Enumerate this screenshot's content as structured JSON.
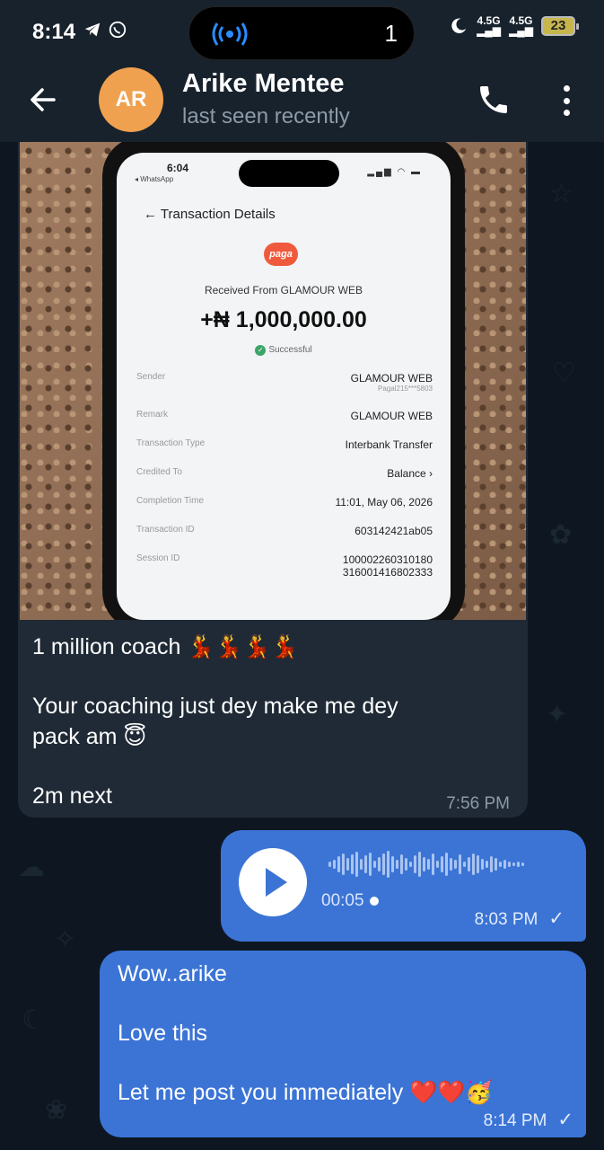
{
  "status_bar": {
    "time": "8:14",
    "island_count": "1",
    "network_1": "4.5G",
    "network_2": "4.5G",
    "battery": "23"
  },
  "header": {
    "avatar_initials": "AR",
    "avatar_color": "#f0a14f",
    "contact_name": "Arike Mentee",
    "contact_status": "last seen recently",
    "icons": [
      "back-arrow-icon",
      "phone-icon",
      "more-vert-icon"
    ]
  },
  "incoming_message": {
    "photo": {
      "phone_time": "6:04",
      "phone_back_app": "◂ WhatsApp",
      "screen_title": "Transaction Details",
      "brand": "paga",
      "received_from": "Received From GLAMOUR WEB",
      "amount": "+₦ 1,000,000.00",
      "status": "Successful",
      "details": [
        {
          "label": "Sender",
          "value": "GLAMOUR WEB",
          "sub": "Pagal215***5803"
        },
        {
          "label": "Remark",
          "value": "GLAMOUR WEB",
          "sub": ""
        },
        {
          "label": "Transaction Type",
          "value": "Interbank Transfer",
          "sub": ""
        },
        {
          "label": "Credited To",
          "value": "Balance ›",
          "sub": ""
        },
        {
          "label": "Completion Time",
          "value": "11:01, May 06, 2026",
          "sub": ""
        },
        {
          "label": "Transaction ID",
          "value": "603142421ab05",
          "sub": ""
        },
        {
          "label": "Session ID",
          "value": "100002260310180",
          "sub": "316001416802333"
        }
      ]
    },
    "caption_line_1": "1 million coach 💃💃💃💃",
    "caption_line_2": "Your coaching just dey make me dey",
    "caption_line_3": "pack am 😇",
    "caption_line_4": "2m next",
    "time": "7:56 PM"
  },
  "voice_message": {
    "duration": "00:05",
    "time": "8:03 PM",
    "status": "✓"
  },
  "outgoing_message": {
    "line_1": "Wow..arike",
    "line_2": "Love this",
    "line_3": "Let me post you immediately ❤️❤️🥳",
    "time": "8:14 PM",
    "status": "✓"
  }
}
